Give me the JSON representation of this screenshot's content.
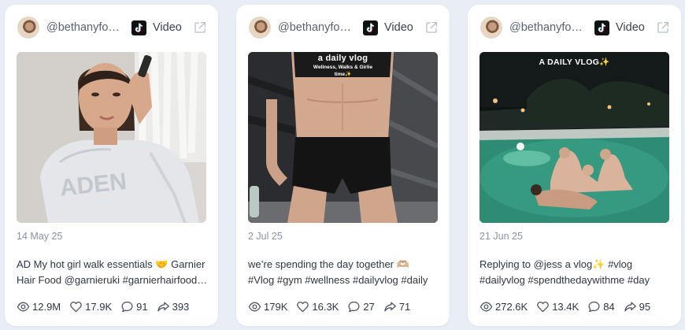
{
  "colors": {
    "page_background": "#e9eef6",
    "card_background": "#ffffff",
    "muted_text": "#8a92a3",
    "icon_stroke": "#4b5262"
  },
  "posts": [
    {
      "handle": "@bethanyfosbrooke",
      "platform_icon": "tiktok-icon",
      "type_label": "Video",
      "thumbnail_overlay": [],
      "date": "14 May 25",
      "caption_line1": "AD My hot girl walk essentials 🤝 Garnier",
      "caption_line2": "Hair Food @garnieruki #garnierhairfood #ad",
      "views": "12.9M",
      "likes": "17.9K",
      "comments": "91",
      "shares": "393"
    },
    {
      "handle": "@bethanyfosbrooke",
      "platform_icon": "tiktok-icon",
      "type_label": "Video",
      "thumbnail_overlay": [
        "a daily vlog",
        "Wellness, Walks & Girlie",
        "time✨"
      ],
      "date": "2 Jul 25",
      "caption_line1": "we’re spending the day together 🫶🏼",
      "caption_line2": "#Vlog #gym #wellness #dailyvlog #daily",
      "views": "179K",
      "likes": "16.3K",
      "comments": "27",
      "shares": "71"
    },
    {
      "handle": "@bethanyfosbrooke",
      "platform_icon": "tiktok-icon",
      "type_label": "Video",
      "thumbnail_overlay": [
        "A DAILY VLOG✨"
      ],
      "date": "21 Jun 25",
      "caption_line1": "Replying to @jess a vlog✨ #vlog",
      "caption_line2": "#dailyvlog #spendthedaywithme #day",
      "views": "272.6K",
      "likes": "13.4K",
      "comments": "84",
      "shares": "95"
    }
  ]
}
